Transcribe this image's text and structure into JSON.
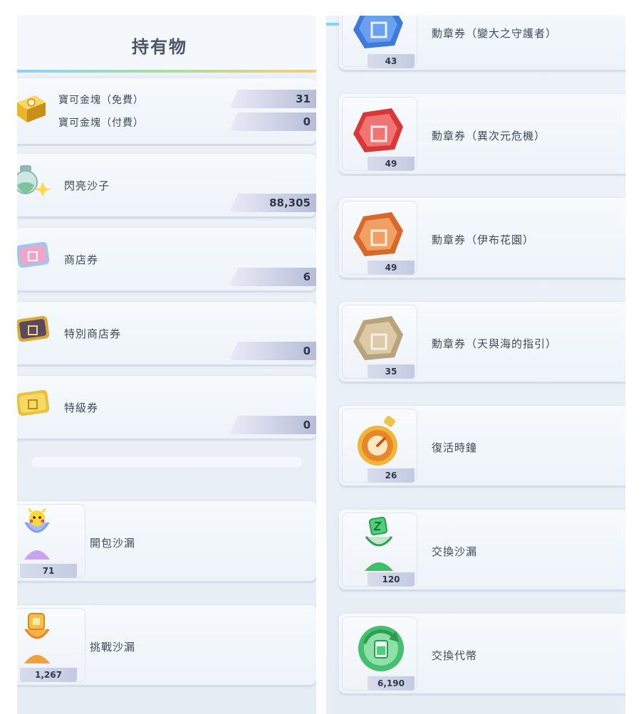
{
  "left": {
    "title": "持有物",
    "gold": {
      "free_label": "寶可金塊（免費）",
      "free_value": "31",
      "paid_label": "寶可金塊（付費）",
      "paid_value": "0"
    },
    "items": [
      {
        "name": "閃亮沙子",
        "value": "88,305",
        "icon": "shiny-sand-icon"
      },
      {
        "name": "商店券",
        "value": "6",
        "icon": "shop-ticket-icon"
      },
      {
        "name": "特別商店券",
        "value": "0",
        "icon": "special-shop-ticket-icon"
      },
      {
        "name": "特級券",
        "value": "0",
        "icon": "premium-ticket-icon"
      }
    ],
    "hourglasses": [
      {
        "name": "開包沙漏",
        "count": "71",
        "icon": "pack-hourglass-icon"
      },
      {
        "name": "挑戰沙漏",
        "count": "1,267",
        "icon": "challenge-hourglass-icon"
      }
    ]
  },
  "right": {
    "items": [
      {
        "name": "勳章券（變大之守護者）",
        "count": "43",
        "icon": "blue-medal-ticket-icon",
        "color": "#3f7bdc"
      },
      {
        "name": "勳章券（異次元危機）",
        "count": "49",
        "icon": "red-medal-ticket-icon",
        "color": "#e24a4a"
      },
      {
        "name": "勳章券（伊布花園）",
        "count": "49",
        "icon": "orange-medal-ticket-icon",
        "color": "#e0782e"
      },
      {
        "name": "勳章券（天與海的指引）",
        "count": "35",
        "icon": "beige-medal-ticket-icon",
        "color": "#c9b48e"
      },
      {
        "name": "復活時鐘",
        "count": "26",
        "icon": "revive-clock-icon",
        "color": "#e8862a"
      },
      {
        "name": "交換沙漏",
        "count": "120",
        "icon": "trade-hourglass-icon",
        "color": "#3fbf6a"
      },
      {
        "name": "交換代幣",
        "count": "6,190",
        "icon": "trade-token-icon",
        "color": "#2fb36a"
      }
    ]
  }
}
